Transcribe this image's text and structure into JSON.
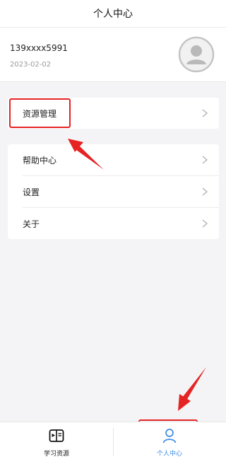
{
  "header": {
    "title": "个人中心"
  },
  "profile": {
    "phone": "139xxxx5991",
    "date": "2023-02-02",
    "avatar_icon": "user-avatar-icon"
  },
  "menu": {
    "resources": "资源管理",
    "help": "帮助中心",
    "settings": "设置",
    "about": "关于",
    "chevron_icon": "chevron-right-icon"
  },
  "tabs": {
    "learn": "学习资源",
    "mine": "个人中心",
    "learn_icon": "book-icon",
    "mine_icon": "person-icon"
  },
  "colors": {
    "accent": "#3b8be6",
    "annotation": "#e52323",
    "background": "#f4f4f6"
  }
}
